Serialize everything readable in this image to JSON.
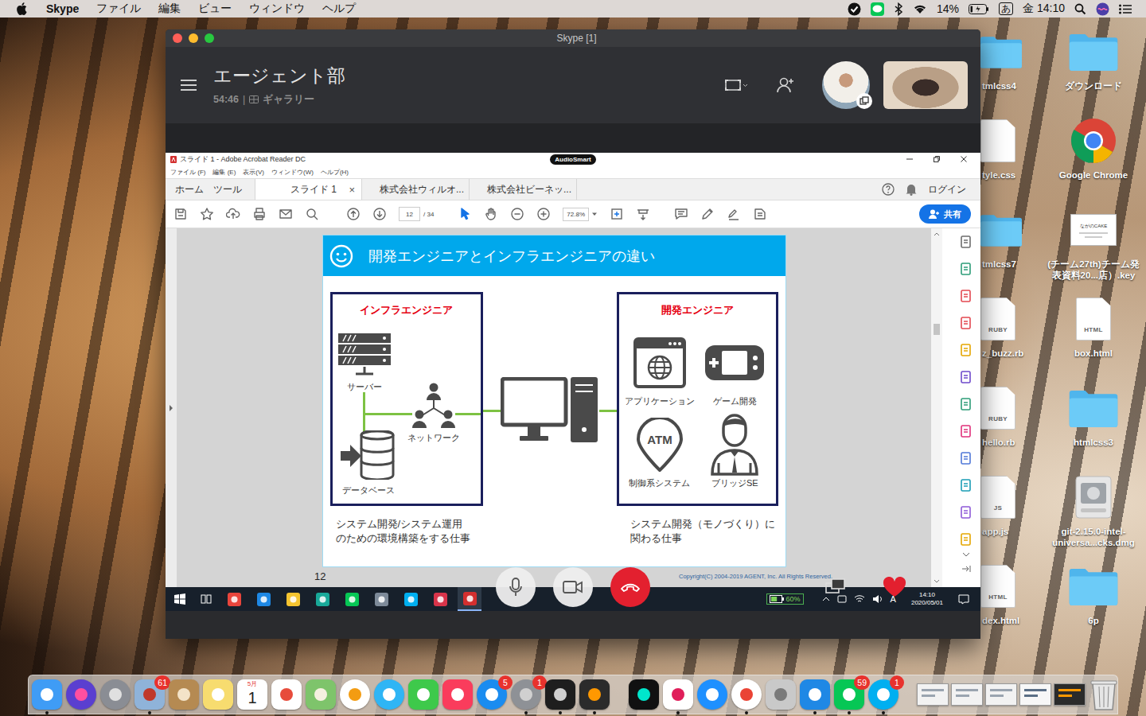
{
  "menubar": {
    "app": "Skype",
    "items": [
      "ファイル",
      "編集",
      "ビュー",
      "ウィンドウ",
      "ヘルプ"
    ],
    "battery": "14%",
    "battery_level": 0.14,
    "input_mode": "あ",
    "clock": "金 14:10"
  },
  "desktop": {
    "hidden_column": [
      {
        "label": "tmlcss4",
        "kind": "folder",
        "tag": ""
      },
      {
        "label": "tyle.css",
        "kind": "file",
        "tag": ""
      },
      {
        "label": "tmlcss7",
        "kind": "folder",
        "tag": ""
      },
      {
        "label": "z_buzz.rb",
        "kind": "file",
        "tag": "RUBY"
      },
      {
        "label": "hello.rb",
        "kind": "file",
        "tag": "RUBY"
      },
      {
        "label": "app.js",
        "kind": "file",
        "tag": "JS"
      },
      {
        "label": "dex.html",
        "kind": "file",
        "tag": "HTML"
      }
    ],
    "column": [
      {
        "label": "ダウンロード",
        "kind": "folder",
        "tag": ""
      },
      {
        "label": "Google Chrome",
        "kind": "chrome",
        "tag": ""
      },
      {
        "label": "(チーム27th)チーム発表資料20...店）.key",
        "kind": "keynote",
        "tag": "ながのCAKE"
      },
      {
        "label": "box.html",
        "kind": "file",
        "tag": "HTML"
      },
      {
        "label": "htmlcss3",
        "kind": "folder",
        "tag": ""
      },
      {
        "label": "git-2.15.0-intel-universa...cks.dmg",
        "kind": "disk",
        "tag": ""
      },
      {
        "label": "6p",
        "kind": "folder",
        "tag": ""
      }
    ]
  },
  "skype": {
    "title": "Skype [1]",
    "chat_name": "エージェント部",
    "duration": "54:46",
    "separator": "|",
    "view": "ギャラリー"
  },
  "acrobat": {
    "title": "スライド 1 - Adobe Acrobat Reader DC",
    "badge": "AudioSmart",
    "menu": [
      "ファイル (F)",
      "編集 (E)",
      "表示(V)",
      "ウィンドウ(W)",
      "ヘルプ(H)"
    ],
    "nav": [
      "ホーム",
      "ツール"
    ],
    "tabs": [
      {
        "label": "スライド 1",
        "selected": true,
        "closable": true
      },
      {
        "label": "株式会社ウィルオ...",
        "selected": false,
        "closable": false
      },
      {
        "label": "株式会社ビーネッ...",
        "selected": false,
        "closable": false
      }
    ],
    "close_glyph": "×",
    "login": "ログイン",
    "page": "12",
    "page_total": "/ 34",
    "zoom": "72.8%",
    "share": "共有",
    "tools": [
      {
        "color": "#6d6d6d"
      },
      {
        "color": "#2d9d78"
      },
      {
        "color": "#e34850"
      },
      {
        "color": "#e34850"
      },
      {
        "color": "#e5a600"
      },
      {
        "color": "#6e49cb"
      },
      {
        "color": "#2d9d78"
      },
      {
        "color": "#e0307a"
      },
      {
        "color": "#5078d8"
      },
      {
        "color": "#1a9db5"
      },
      {
        "color": "#8e5ad8"
      },
      {
        "color": "#e5a600"
      }
    ]
  },
  "slide": {
    "title": "開発エンジニアとインフラエンジニアの違い",
    "left": {
      "heading": "インフラエンジニア",
      "items": [
        {
          "label": "サーバー",
          "kind": "server"
        },
        {
          "label": "ネットワーク",
          "kind": "network"
        },
        {
          "label": "データベース",
          "kind": "database"
        }
      ],
      "caption_lines": [
        "システム開発/システム運用",
        "のための環境構築をする仕事"
      ]
    },
    "right": {
      "heading": "開発エンジニア",
      "items": [
        {
          "label": "アプリケーション",
          "kind": "app",
          "icon_text": ""
        },
        {
          "label": "ゲーム開発",
          "kind": "game",
          "icon_text": ""
        },
        {
          "label": "制御系システム",
          "kind": "atm",
          "icon_text": "ATM"
        },
        {
          "label": "ブリッジSE",
          "kind": "person",
          "icon_text": ""
        }
      ],
      "caption_lines": [
        "システム開発（モノづくり）に",
        "関わる仕事"
      ]
    },
    "page_number": "12",
    "copyright": "Copyright(C) 2004-2019 AGENT, Inc. All Rights Reserved."
  },
  "taskbar": {
    "apps": [
      {
        "color": "#e8453c",
        "active": false
      },
      {
        "color": "#1e88e5",
        "active": false
      },
      {
        "color": "#f4c430",
        "active": false
      },
      {
        "color": "#18a999",
        "active": false
      },
      {
        "color": "#06c755",
        "active": false
      },
      {
        "color": "#7d8a99",
        "active": false
      },
      {
        "color": "#00aff0",
        "active": false
      },
      {
        "color": "#d8344a",
        "active": false
      },
      {
        "color": "#d32f2f",
        "active": true
      }
    ],
    "battery": "60%",
    "battery_level": 0.6,
    "ime": "A",
    "time": "14:10",
    "date": "2020/05/01"
  },
  "dock": {
    "apps": [
      {
        "kind": "app",
        "color": "#3f9cf5",
        "accent": "#ffffff",
        "badge": "",
        "running": true
      },
      {
        "kind": "round",
        "color": "#5a3fd0",
        "accent": "#ff4fa0",
        "badge": "",
        "running": false
      },
      {
        "kind": "round",
        "color": "#8a8d94",
        "accent": "#e0e0e0",
        "badge": "",
        "running": false
      },
      {
        "kind": "app",
        "color": "#8fb3d9",
        "accent": "#c0392b",
        "badge": "61",
        "running": true
      },
      {
        "kind": "app",
        "color": "#b58a52",
        "accent": "#f3e3c8",
        "badge": "",
        "running": false
      },
      {
        "kind": "app",
        "color": "#f7dc6f",
        "accent": "#ffffff",
        "badge": "",
        "running": false
      },
      {
        "kind": "calendar",
        "color": "#ffffff",
        "accent": "#e53935",
        "badge": "",
        "running": false,
        "month": "5月",
        "day": "1"
      },
      {
        "kind": "app",
        "color": "#ffffff",
        "accent": "#e74c3c",
        "badge": "",
        "running": false
      },
      {
        "kind": "app",
        "color": "#7ec46b",
        "accent": "#f5f0e0",
        "badge": "",
        "running": false
      },
      {
        "kind": "round",
        "color": "#ffffff",
        "accent": "#f39c12",
        "badge": "",
        "running": false
      },
      {
        "kind": "round",
        "color": "#2fb5f5",
        "accent": "#ffffff",
        "badge": "",
        "running": false
      },
      {
        "kind": "app",
        "color": "#3ec94b",
        "accent": "#ffffff",
        "badge": "",
        "running": false
      },
      {
        "kind": "app",
        "color": "#fa3c5c",
        "accent": "#ffffff",
        "badge": "",
        "running": false
      },
      {
        "kind": "round",
        "color": "#1a8cf0",
        "accent": "#ffffff",
        "badge": "5",
        "running": false
      },
      {
        "kind": "round",
        "color": "#8e9196",
        "accent": "#d0d0d0",
        "badge": "1",
        "running": true
      },
      {
        "kind": "app",
        "color": "#1e1e1e",
        "accent": "#d0d0d0",
        "badge": "",
        "running": true
      },
      {
        "kind": "app",
        "color": "#2b2b2b",
        "accent": "#ff9800",
        "badge": "",
        "running": true
      }
    ],
    "others": [
      {
        "kind": "app",
        "color": "#111111",
        "accent": "#00e6cc",
        "badge": "",
        "running": false
      },
      {
        "kind": "app",
        "color": "#ffffff",
        "accent": "#e01e5a",
        "badge": "",
        "running": true
      },
      {
        "kind": "round",
        "color": "#1e90ff",
        "accent": "#ffffff",
        "badge": "",
        "running": false
      },
      {
        "kind": "round",
        "color": "#ffffff",
        "accent": "#ea4335",
        "badge": "",
        "running": true
      },
      {
        "kind": "app",
        "color": "#c9c9c9",
        "accent": "#7a7a7a",
        "badge": "",
        "running": false
      },
      {
        "kind": "app",
        "color": "#1f88e5",
        "accent": "#ffffff",
        "badge": "",
        "running": true
      },
      {
        "kind": "app",
        "color": "#06c755",
        "accent": "#ffffff",
        "badge": "59",
        "running": true
      },
      {
        "kind": "round",
        "color": "#00aff0",
        "accent": "#ffffff",
        "badge": "1",
        "running": true
      }
    ],
    "windows": [
      {
        "kind": "window",
        "color": "#f2f2f2",
        "accent": "#9aa4b0",
        "badge": "",
        "running": false
      },
      {
        "kind": "window",
        "color": "#f2f2f2",
        "accent": "#9aa4b0",
        "badge": "",
        "running": false
      },
      {
        "kind": "window",
        "color": "#f2f2f2",
        "accent": "#9aa4b0",
        "badge": "",
        "running": false
      },
      {
        "kind": "window",
        "color": "#f7f7f7",
        "accent": "#5b6f86",
        "badge": "",
        "running": false
      },
      {
        "kind": "window",
        "color": "#2b2b2b",
        "accent": "#ff9800",
        "badge": "",
        "running": false
      },
      {
        "kind": "trash",
        "color": "#e6e6e6",
        "accent": "#8a8a8a",
        "badge": "",
        "running": false
      }
    ]
  }
}
